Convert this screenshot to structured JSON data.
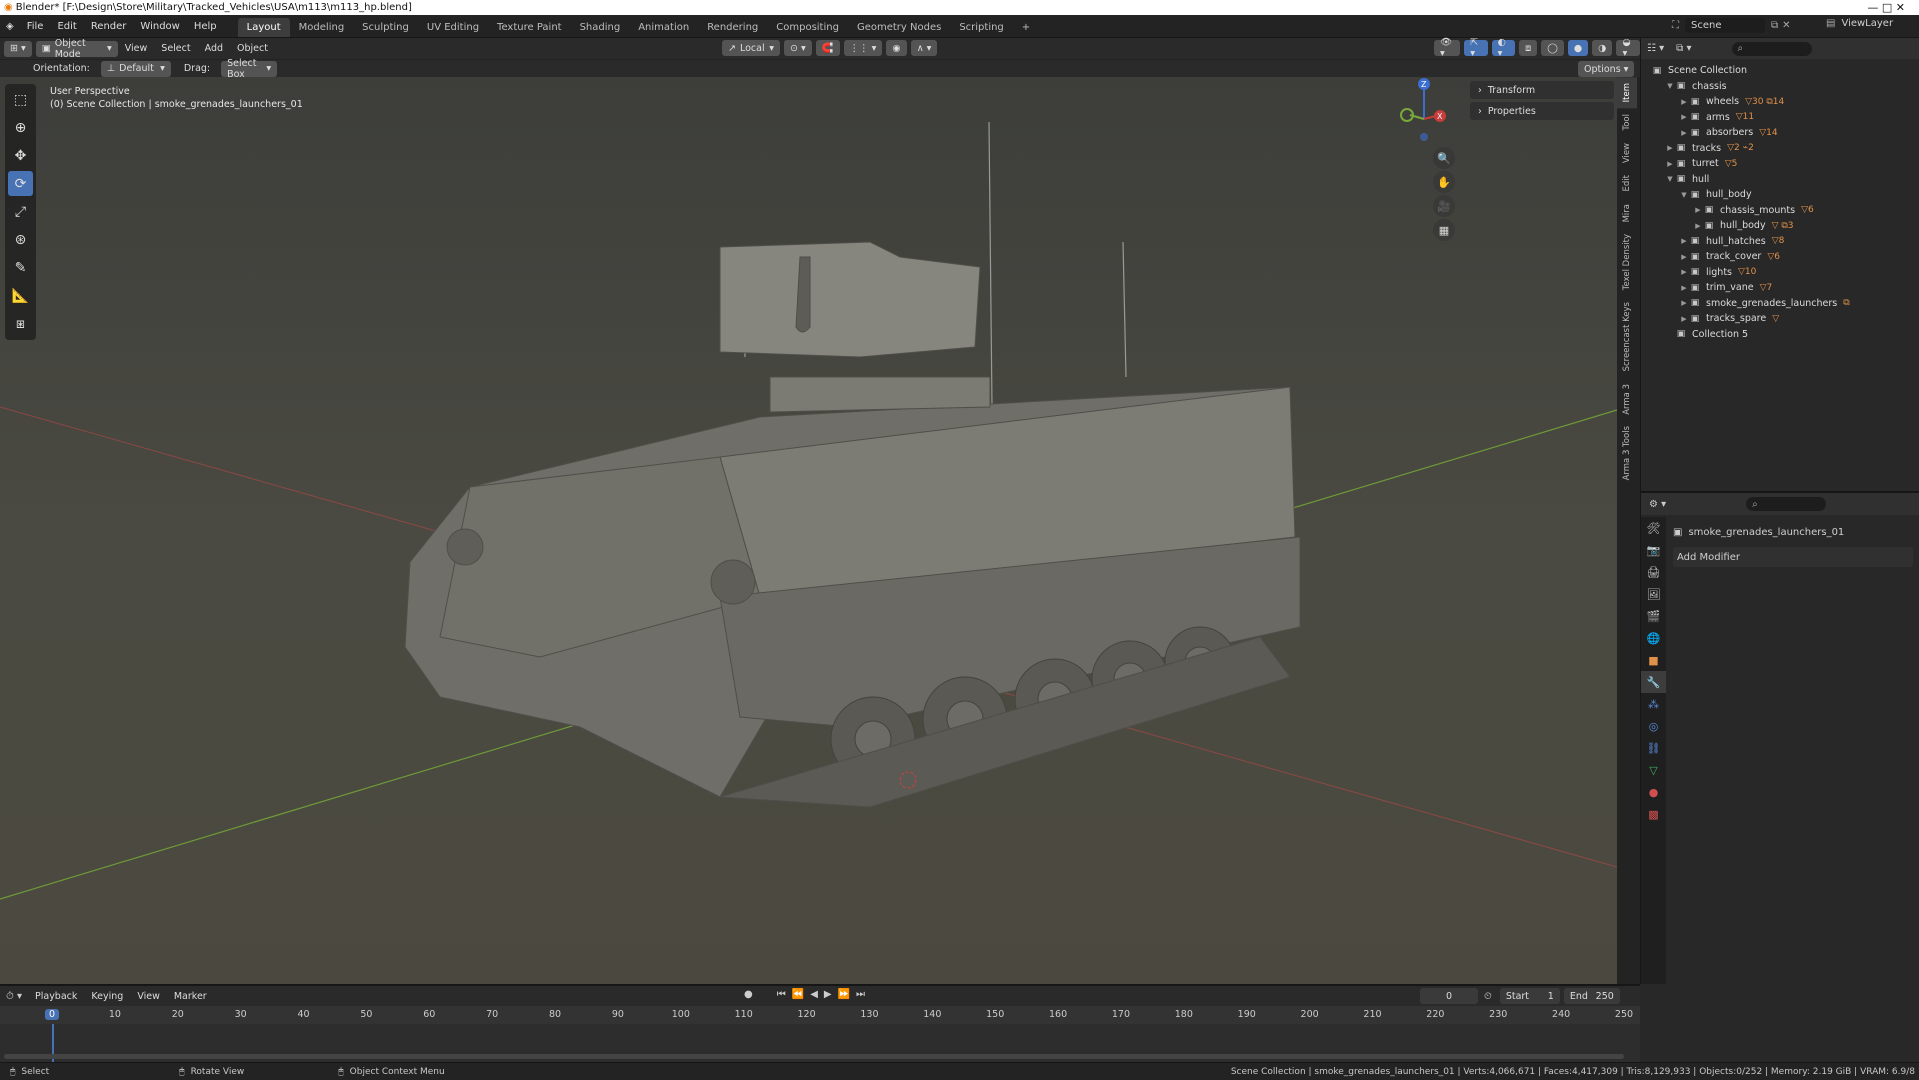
{
  "window": {
    "title": "Blender* [F:\\Design\\Store\\Military\\Tracked_Vehicles\\USA\\m113\\m113_hp.blend]",
    "controls": "—   □   ✕"
  },
  "menus": [
    "File",
    "Edit",
    "Render",
    "Window",
    "Help"
  ],
  "workspaces": [
    "Layout",
    "Modeling",
    "Sculpting",
    "UV Editing",
    "Texture Paint",
    "Shading",
    "Animation",
    "Rendering",
    "Compositing",
    "Geometry Nodes",
    "Scripting",
    "+"
  ],
  "scene": {
    "label": "Scene",
    "view_layer": "ViewLayer"
  },
  "viewport_header": {
    "mode": "Object Mode",
    "menus": [
      "View",
      "Select",
      "Add",
      "Object"
    ],
    "transform_space": "Local",
    "options_label": "Options"
  },
  "tool_header": {
    "orientation_label": "Orientation:",
    "orientation_value": "Default",
    "drag_label": "Drag:",
    "drag_value": "Select Box"
  },
  "viewport": {
    "view_name": "User Perspective",
    "collection_path": "(0) Scene Collection | smoke_grenades_launchers_01",
    "gizmo_axes": {
      "z": "Z",
      "x": "X"
    },
    "panels": [
      "Transform",
      "Properties"
    ]
  },
  "side_tabs": [
    "Item",
    "Tool",
    "View",
    "Edit",
    "Mira",
    "Texel Density",
    "Screencast Keys",
    "Arma 3",
    "Arma 3 Tools"
  ],
  "outliner": {
    "root": "Scene Collection",
    "rows": [
      {
        "label": "chassis",
        "depth": 1,
        "expanded": true
      },
      {
        "label": "wheels",
        "depth": 2,
        "tag": "▽30 ⧉14"
      },
      {
        "label": "arms",
        "depth": 2,
        "tag": "▽11"
      },
      {
        "label": "absorbers",
        "depth": 2,
        "tag": "▽14"
      },
      {
        "label": "tracks",
        "depth": 1,
        "tag": "▽2 ⌁2"
      },
      {
        "label": "turret",
        "depth": 1,
        "tag": "▽5"
      },
      {
        "label": "hull",
        "depth": 1,
        "expanded": true
      },
      {
        "label": "hull_body",
        "depth": 2,
        "expanded": true
      },
      {
        "label": "chassis_mounts",
        "depth": 3,
        "tag": "▽6"
      },
      {
        "label": "hull_body",
        "depth": 3,
        "tag": "▽ ⧉3"
      },
      {
        "label": "hull_hatches",
        "depth": 2,
        "tag": "▽8"
      },
      {
        "label": "track_cover",
        "depth": 2,
        "tag": "▽6"
      },
      {
        "label": "lights",
        "depth": 2,
        "tag": "▽10"
      },
      {
        "label": "trim_vane",
        "depth": 2,
        "tag": "▽7"
      },
      {
        "label": "smoke_grenades_launchers",
        "depth": 2,
        "tag": "⧉"
      },
      {
        "label": "tracks_spare",
        "depth": 2,
        "tag": "▽"
      },
      {
        "label": "Collection 5",
        "depth": 1
      }
    ]
  },
  "properties": {
    "object_name": "smoke_grenades_launchers_01",
    "add_modifier": "Add Modifier"
  },
  "timeline": {
    "menus": [
      "Playback",
      "Keying",
      "View",
      "Marker"
    ],
    "current_frame": "0",
    "start_label": "Start",
    "start_value": "1",
    "end_label": "End",
    "end_value": "250",
    "ruler": [
      "0",
      "10",
      "20",
      "30",
      "40",
      "50",
      "60",
      "70",
      "80",
      "90",
      "100",
      "110",
      "120",
      "130",
      "140",
      "150",
      "160",
      "170",
      "180",
      "190",
      "200",
      "210",
      "220",
      "230",
      "240",
      "250"
    ]
  },
  "statusbar": {
    "left1": "Select",
    "left2": "Rotate View",
    "left3": "Object Context Menu",
    "right": "Scene Collection | smoke_grenades_launchers_01 | Verts:4,066,671 | Faces:4,417,309 | Tris:8,129,933 | Objects:0/252 | Memory: 2.19 GiB | VRAM: 6.9/8"
  },
  "colors": {
    "accent": "#4772b3",
    "grid_x": "#a84848",
    "grid_y": "#6e9a38",
    "tag": "#e0914a"
  }
}
